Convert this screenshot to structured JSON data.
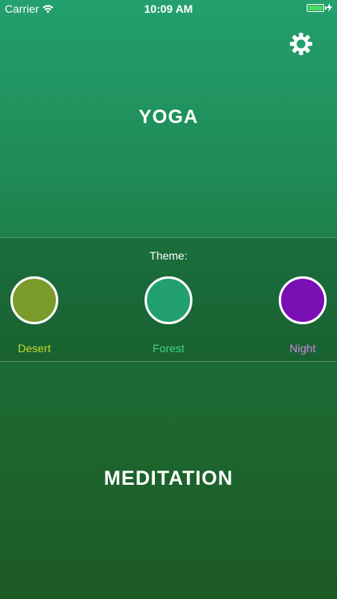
{
  "status_bar": {
    "carrier": "Carrier",
    "time": "10:09 AM",
    "battery_level": 1.0
  },
  "header": {
    "settings_icon": "gear-icon"
  },
  "sections": {
    "top_title": "YOGA",
    "bottom_title": "MEDITATION"
  },
  "theme": {
    "label": "Theme:",
    "options": [
      {
        "label": "Desert",
        "swatch_color": "#7a9a2a",
        "label_color": "#c8d82a"
      },
      {
        "label": "Forest",
        "swatch_color": "#23a072",
        "label_color": "#3dd68c"
      },
      {
        "label": "Night",
        "swatch_color": "#7a0fb4",
        "label_color": "#c98ae6"
      }
    ]
  }
}
